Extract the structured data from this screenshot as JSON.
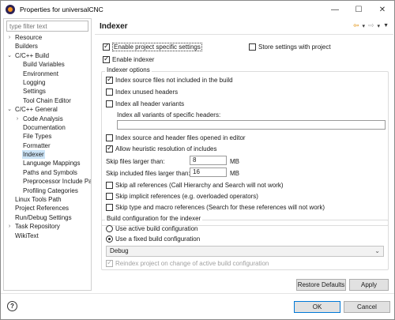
{
  "window": {
    "title": "Properties for universalCNC",
    "controls": [
      "—",
      "☐",
      "✕"
    ]
  },
  "filter": {
    "placeholder": "type filter text"
  },
  "tree": [
    {
      "label": "Resource",
      "level": 0,
      "expandable": true,
      "expanded": false
    },
    {
      "label": "Builders",
      "level": 0,
      "expandable": false
    },
    {
      "label": "C/C++ Build",
      "level": 0,
      "expandable": true,
      "expanded": true
    },
    {
      "label": "Build Variables",
      "level": 1,
      "expandable": false
    },
    {
      "label": "Environment",
      "level": 1,
      "expandable": false
    },
    {
      "label": "Logging",
      "level": 1,
      "expandable": false
    },
    {
      "label": "Settings",
      "level": 1,
      "expandable": false
    },
    {
      "label": "Tool Chain Editor",
      "level": 1,
      "expandable": false
    },
    {
      "label": "C/C++ General",
      "level": 0,
      "expandable": true,
      "expanded": true
    },
    {
      "label": "Code Analysis",
      "level": 1,
      "expandable": true,
      "expanded": false
    },
    {
      "label": "Documentation",
      "level": 1,
      "expandable": false
    },
    {
      "label": "File Types",
      "level": 1,
      "expandable": false
    },
    {
      "label": "Formatter",
      "level": 1,
      "expandable": false
    },
    {
      "label": "Indexer",
      "level": 1,
      "expandable": false,
      "selected": true
    },
    {
      "label": "Language Mappings",
      "level": 1,
      "expandable": false
    },
    {
      "label": "Paths and Symbols",
      "level": 1,
      "expandable": false
    },
    {
      "label": "Preprocessor Include Pa",
      "level": 1,
      "expandable": false
    },
    {
      "label": "Profiling Categories",
      "level": 1,
      "expandable": false
    },
    {
      "label": "Linux Tools Path",
      "level": 0,
      "expandable": false
    },
    {
      "label": "Project References",
      "level": 0,
      "expandable": false
    },
    {
      "label": "Run/Debug Settings",
      "level": 0,
      "expandable": false
    },
    {
      "label": "Task Repository",
      "level": 0,
      "expandable": true,
      "expanded": false
    },
    {
      "label": "WikiText",
      "level": 0,
      "expandable": false
    }
  ],
  "page": {
    "title": "Indexer",
    "enable_project_settings": {
      "label": "Enable project specific settings",
      "checked": true
    },
    "store_settings": {
      "label": "Store settings with project",
      "checked": false
    },
    "enable_indexer": {
      "label": "Enable indexer",
      "checked": true
    },
    "options_group": {
      "title": "Indexer options",
      "index_source_not_in_build": {
        "label": "Index source files not included in the build",
        "checked": true
      },
      "index_unused_headers": {
        "label": "Index unused headers",
        "checked": false
      },
      "index_all_header_variants": {
        "label": "Index all header variants",
        "checked": false
      },
      "variants_label": "Index all variants of specific headers:",
      "variants_value": "",
      "index_opened_in_editor": {
        "label": "Index source and header files opened in editor",
        "checked": false
      },
      "heuristic_includes": {
        "label": "Allow heuristic resolution of includes",
        "checked": true
      },
      "skip_files_larger": {
        "label": "Skip files larger than:",
        "value": "8",
        "unit": "MB"
      },
      "skip_included_larger": {
        "label": "Skip included files larger than:",
        "value": "16",
        "unit": "MB"
      },
      "skip_all_references": {
        "label": "Skip all references (Call Hierarchy and Search will not work)",
        "checked": false
      },
      "skip_implicit_references": {
        "label": "Skip implicit references (e.g. overloaded operators)",
        "checked": false
      },
      "skip_type_macro_references": {
        "label": "Skip type and macro references (Search for these references will not work)",
        "checked": false
      }
    },
    "build_config_group": {
      "title": "Build configuration for the indexer",
      "use_active": {
        "label": "Use active build configuration",
        "selected": false
      },
      "use_fixed": {
        "label": "Use a fixed build configuration",
        "selected": true
      },
      "config_value": "Debug",
      "reindex": {
        "label": "Reindex project on change of active build configuration",
        "checked": true,
        "disabled": true
      }
    },
    "restore_defaults_label": "Restore Defaults",
    "apply_label": "Apply"
  },
  "footer": {
    "help_symbol": "?",
    "ok_label": "OK",
    "cancel_label": "Cancel"
  }
}
